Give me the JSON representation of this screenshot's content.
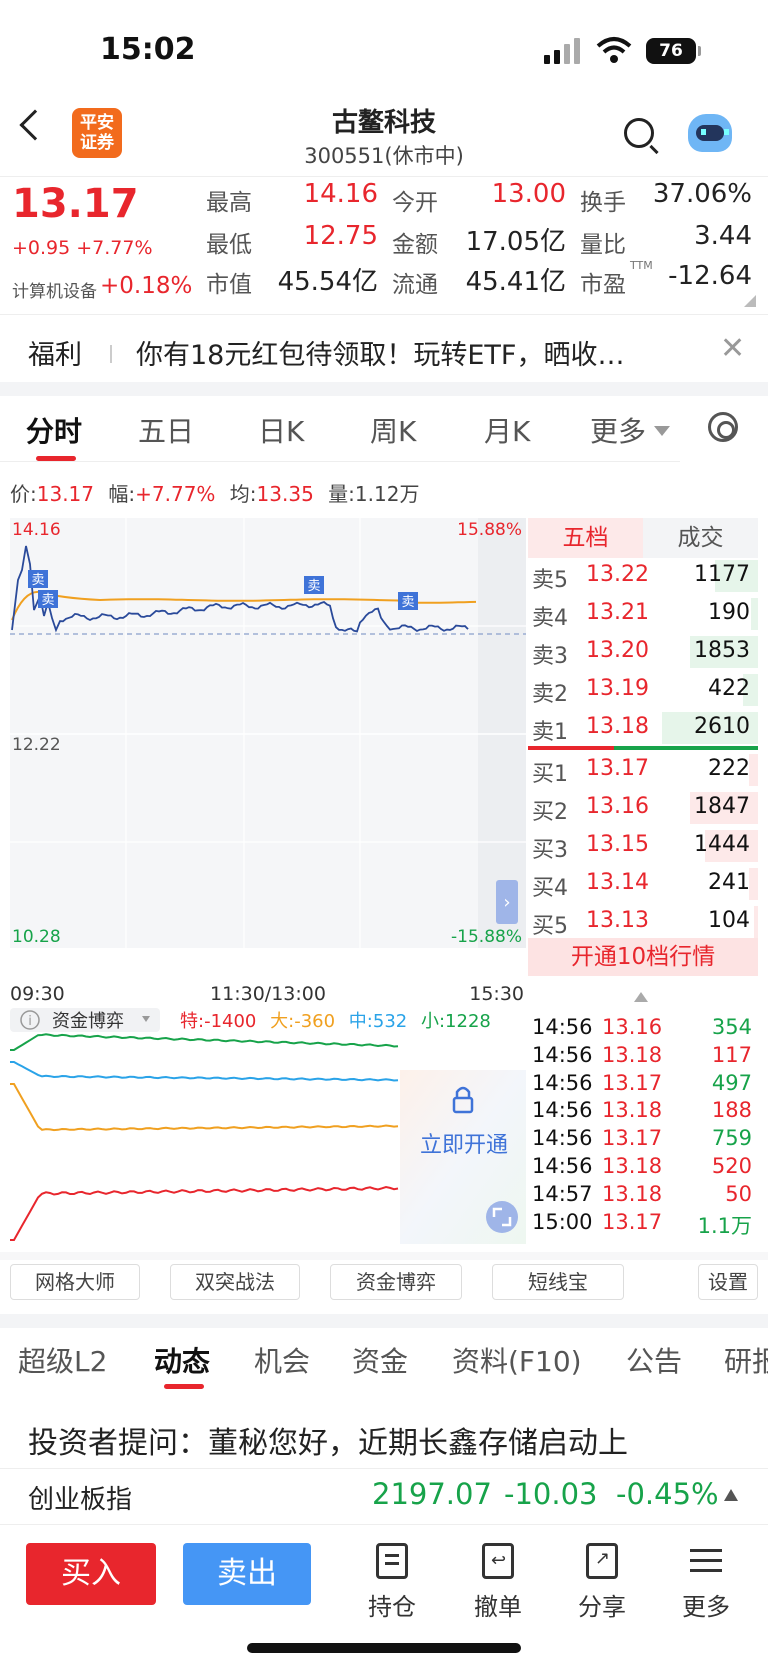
{
  "status_bar": {
    "time": "15:02",
    "battery": "76"
  },
  "header": {
    "logo_text": "平安证券",
    "name": "古鳌科技",
    "code": "300551(休市中)"
  },
  "quote": {
    "price": "13.17",
    "change": "+0.95  +7.77%",
    "industry": "计算机设备",
    "industry_change": "+0.18%",
    "fields": [
      {
        "label": "最高",
        "value": "14.16",
        "color": "red"
      },
      {
        "label": "今开",
        "value": "13.00",
        "color": "red"
      },
      {
        "label": "换手",
        "value": "37.06%",
        "color": "black"
      },
      {
        "label": "最低",
        "value": "12.75",
        "color": "red"
      },
      {
        "label": "金额",
        "value": "17.05亿",
        "color": "black"
      },
      {
        "label": "量比",
        "value": "3.44",
        "color": "black"
      },
      {
        "label": "市值",
        "value": "45.54亿",
        "color": "black"
      },
      {
        "label": "流通",
        "value": "45.41亿",
        "color": "black"
      },
      {
        "label": "市盈",
        "value": "-12.64",
        "color": "black",
        "sup": "TTM"
      }
    ]
  },
  "promo": {
    "label": "福利",
    "text": "你有18元红包待领取！玩转ETF，晒收…"
  },
  "chart_tabs": [
    "分时",
    "五日",
    "日K",
    "周K",
    "月K",
    "更多"
  ],
  "info_bar": {
    "price_label": "价:",
    "price": "13.17",
    "range_label": "幅:",
    "range": "+7.77%",
    "avg_label": "均:",
    "avg": "13.35",
    "vol_label": "量:",
    "vol": "1.12万"
  },
  "intraday": {
    "y_top": "14.16",
    "y_mid": "12.22",
    "y_bottom": "10.28",
    "pct_top": "15.88%",
    "pct_bottom": "-15.88%",
    "x_start": "09:30",
    "x_mid": "11:30/13:00",
    "x_end": "15:30",
    "markers": [
      "卖",
      "卖",
      "卖",
      "卖"
    ]
  },
  "fund": {
    "title": "资金博弈",
    "te_label": "特:",
    "te": "-1400",
    "da_label": "大:",
    "da": "-360",
    "zhong_label": "中:",
    "zhong": "532",
    "xiao_label": "小:",
    "xiao": "1228",
    "unlock": "立即开通"
  },
  "book": {
    "tab_left": "五档",
    "tab_right": "成交",
    "asks": [
      {
        "label": "卖5",
        "price": "13.22",
        "vol": "1177",
        "bar": 0.45
      },
      {
        "label": "卖4",
        "price": "13.21",
        "vol": "190",
        "bar": 0.07
      },
      {
        "label": "卖3",
        "price": "13.20",
        "vol": "1853",
        "bar": 0.71
      },
      {
        "label": "卖2",
        "price": "13.19",
        "vol": "422",
        "bar": 0.16
      },
      {
        "label": "卖1",
        "price": "13.18",
        "vol": "2610",
        "bar": 1.0
      }
    ],
    "bids": [
      {
        "label": "买1",
        "price": "13.17",
        "vol": "222",
        "bar": 0.09
      },
      {
        "label": "买2",
        "price": "13.16",
        "vol": "1847",
        "bar": 0.71
      },
      {
        "label": "买3",
        "price": "13.15",
        "vol": "1444",
        "bar": 0.55
      },
      {
        "label": "买4",
        "price": "13.14",
        "vol": "241",
        "bar": 0.09
      },
      {
        "label": "买5",
        "price": "13.13",
        "vol": "104",
        "bar": 0.04
      }
    ],
    "upgrade": "开通10档行情"
  },
  "ticks": [
    {
      "time": "14:56",
      "price": "13.16",
      "vol": "354",
      "dir": "green"
    },
    {
      "time": "14:56",
      "price": "13.18",
      "vol": "117",
      "dir": "red"
    },
    {
      "time": "14:56",
      "price": "13.17",
      "vol": "497",
      "dir": "green"
    },
    {
      "time": "14:56",
      "price": "13.18",
      "vol": "188",
      "dir": "red"
    },
    {
      "time": "14:56",
      "price": "13.17",
      "vol": "759",
      "dir": "green"
    },
    {
      "time": "14:56",
      "price": "13.18",
      "vol": "520",
      "dir": "red"
    },
    {
      "time": "14:57",
      "price": "13.18",
      "vol": "50",
      "dir": "red"
    },
    {
      "time": "15:00",
      "price": "13.17",
      "vol": "1.1万",
      "dir": "green"
    }
  ],
  "tools": [
    "网格大师",
    "双突战法",
    "资金博弈",
    "短线宝",
    "设置"
  ],
  "info_tabs": [
    "超级L2",
    "动态",
    "机会",
    "资金",
    "资料(F10)",
    "公告",
    "研报"
  ],
  "news": "投资者提问：董秘您好，近期长鑫存储启动上",
  "index": {
    "name": "创业板指",
    "value": "2197.07",
    "change": "-10.03",
    "pct": "-0.45%"
  },
  "bottom": {
    "buy": "买入",
    "sell": "卖出",
    "nav": [
      "持仓",
      "撤单",
      "分享",
      "更多"
    ]
  },
  "colors": {
    "up": "#e8262d",
    "down": "#17a34a",
    "accent_blue": "#4596f5",
    "avg_line": "#f0a020"
  }
}
